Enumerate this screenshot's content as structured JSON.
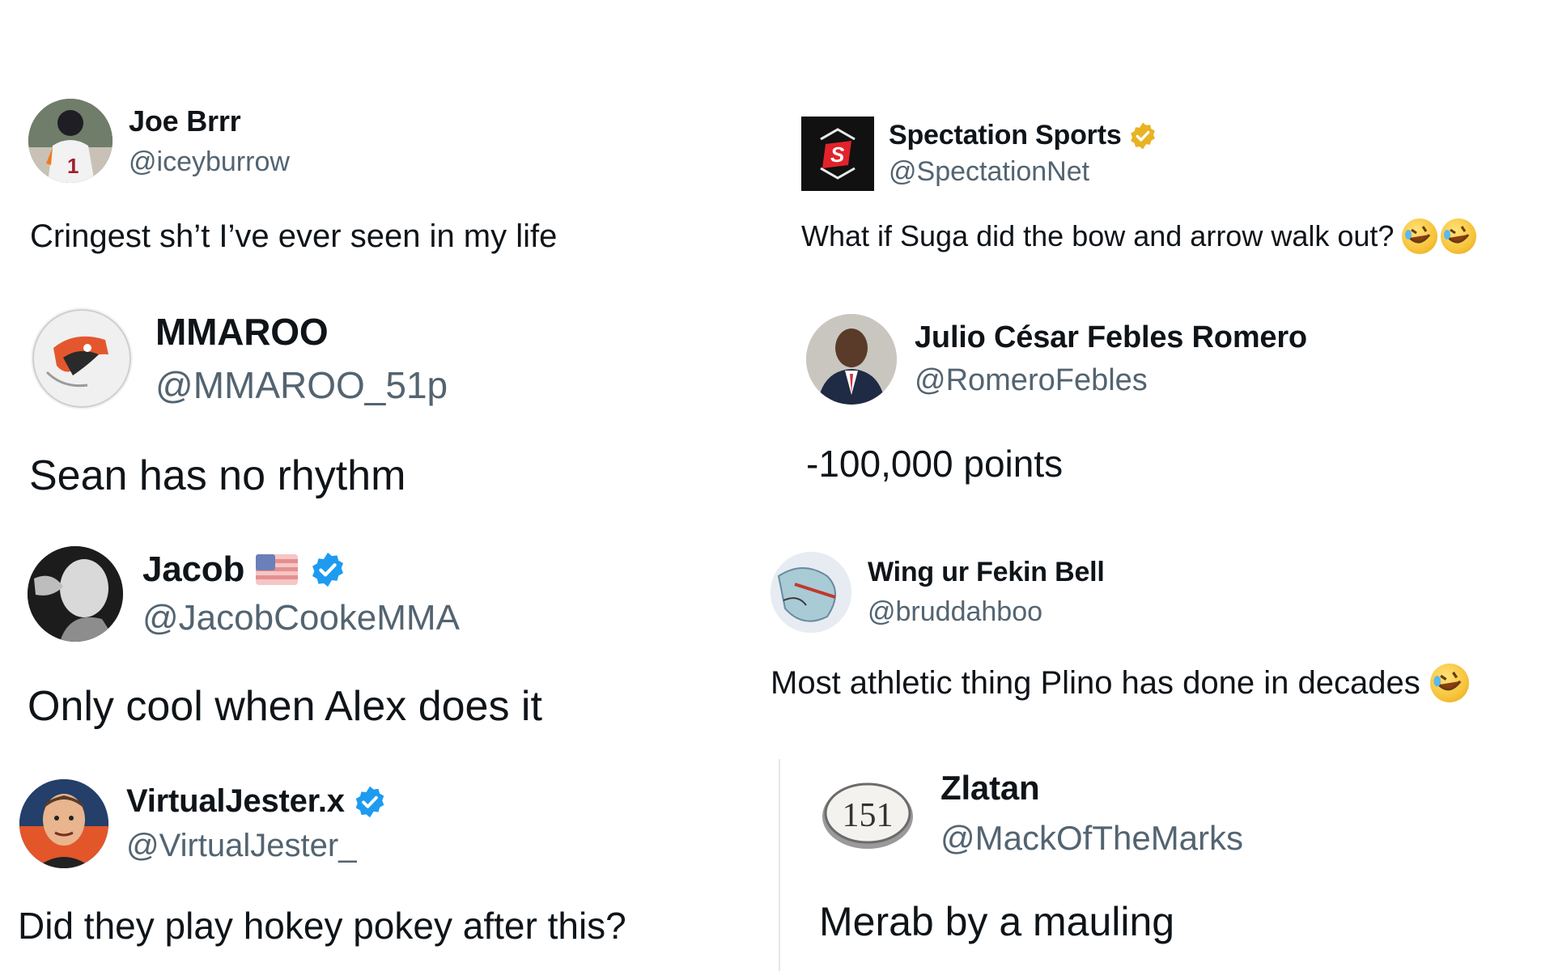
{
  "colors": {
    "text": "#0f1419",
    "handle": "#536471",
    "verified_blue": "#1d9bf0",
    "verified_gold": "#e8b322"
  },
  "tweets": [
    {
      "name": "Joe Brrr",
      "handle": "@iceyburrow",
      "text": "Cringest sh’t I’ve ever seen in my life",
      "avatar_icon": "football-player-avatar"
    },
    {
      "name": "MMAROO",
      "handle": "@MMAROO_51p",
      "text": "Sean has no rhythm",
      "avatar_icon": "kangaroo-logo-avatar"
    },
    {
      "name": "Jacob",
      "handle": "@JacobCookeMMA",
      "text": "Only cool when Alex does it",
      "avatar_icon": "fighter-bw-avatar",
      "badges": [
        "us-flag-icon",
        "verified-blue-icon"
      ]
    },
    {
      "name": "VirtualJester.x",
      "handle": "@VirtualJester_",
      "text": "Did they play hokey pokey after this?",
      "avatar_icon": "cartoon-man-avatar",
      "badges": [
        "verified-blue-icon"
      ]
    },
    {
      "name": "Spectation Sports",
      "handle": "@SpectationNet",
      "text": "What if Suga did the bow and arrow walk out?",
      "avatar_icon": "spectation-logo-avatar",
      "avatar_letter": "S",
      "badges": [
        "verified-gold-icon"
      ],
      "emojis": [
        "rofl-emoji",
        "rofl-emoji"
      ]
    },
    {
      "name": "Julio César Febles Romero",
      "handle": "@RomeroFebles",
      "text": "-100,000 points",
      "avatar_icon": "man-in-suit-avatar"
    },
    {
      "name": "Wing ur Fekin Bell",
      "handle": "@bruddahboo",
      "text": "Most athletic thing Plino has done in decades",
      "avatar_icon": "map-drawing-avatar",
      "emojis": [
        "rofl-emoji"
      ]
    },
    {
      "name": "Zlatan",
      "handle": "@MackOfTheMarks",
      "text": "Merab by a mauling",
      "avatar_icon": "151-logo-avatar",
      "avatar_label": "151"
    }
  ]
}
